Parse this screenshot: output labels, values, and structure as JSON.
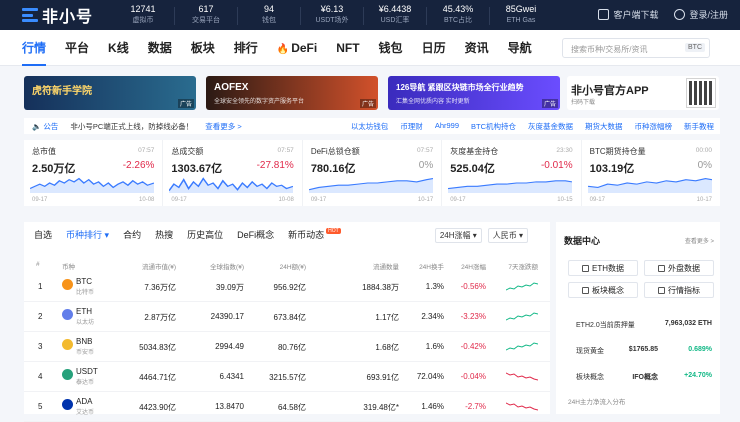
{
  "brand": {
    "logo_text": "非小号"
  },
  "stats": [
    {
      "value": "12741",
      "label": "虚拟币"
    },
    {
      "value": "617",
      "label": "交易平台"
    },
    {
      "value": "94",
      "label": "钱包"
    },
    {
      "value": "¥6.13",
      "label": "USDT场外"
    },
    {
      "value": "¥6.4438",
      "label": "USD汇率"
    },
    {
      "value": "45.43%",
      "label": "BTC占比"
    },
    {
      "value": "85Gwei",
      "label": "ETH Gas"
    }
  ],
  "top_right": {
    "download": "客户端下载",
    "login": "登录/注册"
  },
  "nav": {
    "items": [
      "行情",
      "平台",
      "K线",
      "数据",
      "板块",
      "排行",
      "DeFi",
      "NFT",
      "钱包",
      "日历",
      "资讯",
      "导航"
    ],
    "active_index": 0,
    "fire_item": "DeFi"
  },
  "search": {
    "placeholder": "搜索币种/交易所/资讯",
    "badge": "BTC"
  },
  "banners": [
    {
      "title": "虎符新手学院",
      "subtitle": "",
      "ad": "广告"
    },
    {
      "title": "AOFEX",
      "subtitle": "全球安全领先的数字资产服务平台",
      "ad": "广告"
    },
    {
      "title": "126导航 紧跟区块链市场全行业趋势",
      "subtitle": "汇集全网优质内容 实时更新",
      "ad": "广告"
    }
  ],
  "app_promo": {
    "title": "非小号官方APP",
    "subtitle": "扫码下载"
  },
  "notice": {
    "tag": "公告",
    "message": "非小号PC端正式上线，防掉线必备！",
    "more": "查看更多 >",
    "links": [
      "以太坊钱包",
      "币理财",
      "Ahr999",
      "BTC机构持仓",
      "灰度基金数据",
      "期货大数据",
      "币种涨幅榜",
      "新手教程"
    ]
  },
  "kpis": [
    {
      "name": "总市值",
      "time": "07:57",
      "value": "2.50万亿",
      "change": "-2.26%",
      "trend": "down",
      "start": "09-17",
      "end": "10-08"
    },
    {
      "name": "总成交额",
      "time": "07:57",
      "value": "1303.67亿",
      "change": "-27.81%",
      "trend": "down",
      "start": "09-17",
      "end": "10-08"
    },
    {
      "name": "DeFi总锁仓额",
      "time": "07:57",
      "value": "780.16亿",
      "change": "0%",
      "trend": "flat",
      "start": "09-17",
      "end": "10-17"
    },
    {
      "name": "灰度基金持仓",
      "time": "23:30",
      "value": "525.04亿",
      "change": "-0.01%",
      "trend": "down",
      "start": "09-17",
      "end": "10-15"
    },
    {
      "name": "BTC期货持仓量",
      "time": "00:00",
      "value": "103.19亿",
      "change": "0%",
      "trend": "flat",
      "start": "09-17",
      "end": "10-17"
    }
  ],
  "market": {
    "tabs": [
      "自选",
      "币种排行",
      "合约",
      "热搜",
      "历史高位",
      "DeFi概念",
      "新币动态"
    ],
    "active_tab": 1,
    "hot_badge": "HOT",
    "selectors": [
      "24H涨幅",
      "人民币"
    ],
    "headers": [
      "#",
      "币种",
      "流通市值(¥)",
      "全球指数(¥)",
      "24H额(¥)",
      "流通数量",
      "24H换手",
      "24H涨幅",
      "7天涨跌额"
    ],
    "rows": [
      {
        "rank": "1",
        "symbol": "BTC",
        "name": "比特币",
        "mcap": "7.36万亿",
        "price": "39.09万",
        "vol": "956.92亿",
        "supply": "1884.38万",
        "turnover": "1.3%",
        "change": "-0.56%",
        "trend": "up",
        "color": "#f7931a"
      },
      {
        "rank": "2",
        "symbol": "ETH",
        "name": "以太坊",
        "mcap": "2.87万亿",
        "price": "24390.17",
        "vol": "673.84亿",
        "supply": "1.17亿",
        "turnover": "2.34%",
        "change": "-3.23%",
        "trend": "up",
        "color": "#627eea"
      },
      {
        "rank": "3",
        "symbol": "BNB",
        "name": "币安币",
        "mcap": "5034.83亿",
        "price": "2994.49",
        "vol": "80.76亿",
        "supply": "1.68亿",
        "turnover": "1.6%",
        "change": "-0.42%",
        "trend": "up",
        "color": "#f3ba2f"
      },
      {
        "rank": "4",
        "symbol": "USDT",
        "name": "泰达币",
        "mcap": "4464.71亿",
        "price": "6.4341",
        "vol": "3215.57亿",
        "supply": "693.91亿",
        "turnover": "72.04%",
        "change": "-0.04%",
        "trend": "down",
        "color": "#26a17b"
      },
      {
        "rank": "5",
        "symbol": "ADA",
        "name": "艾达币",
        "mcap": "4423.90亿",
        "price": "13.8470",
        "vol": "64.58亿",
        "supply": "319.48亿*",
        "turnover": "1.46%",
        "change": "-2.7%",
        "trend": "down",
        "color": "#0033ad"
      }
    ]
  },
  "datacenter": {
    "title": "数据中心",
    "more": "查看更多 >",
    "buttons": [
      "ETH数据",
      "外盘数据",
      "板块概念",
      "行情指标"
    ],
    "rows": [
      {
        "label": "ETH2.0当前质押量",
        "value": "7,963,032 ETH",
        "value2": ""
      },
      {
        "label": "现货黄金",
        "value": "0.689%",
        "value2": "$1765.85"
      },
      {
        "label": "板块概念",
        "value": "+24.70%",
        "value2": "IFO概念"
      }
    ],
    "footer": "24H主力净流入分布"
  }
}
